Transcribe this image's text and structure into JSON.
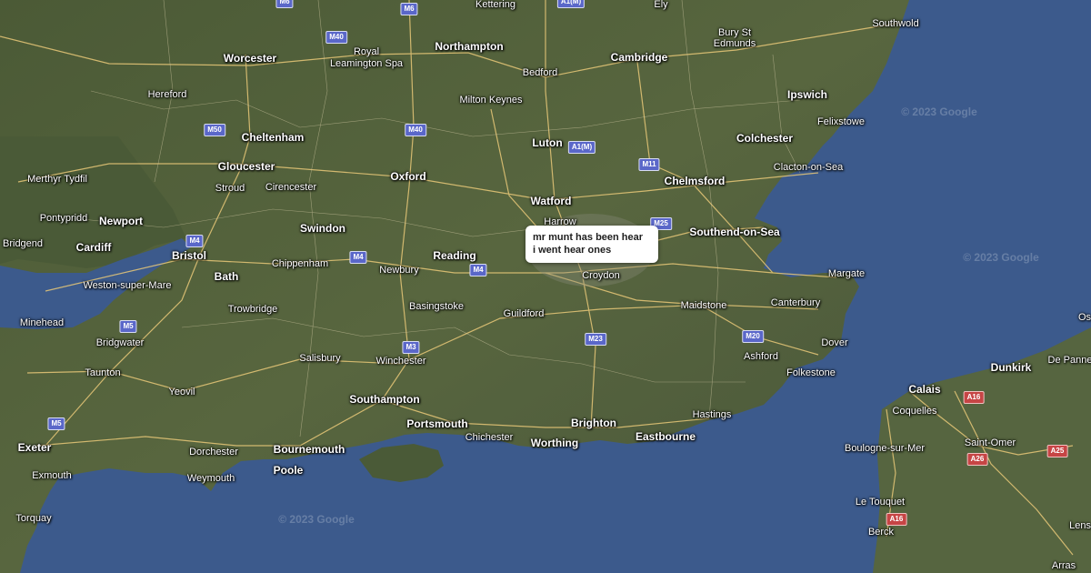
{
  "colors": {
    "sea": "#3c5a8c",
    "land_dark": "#3a4a2d",
    "land_mid": "#55643e",
    "land_light": "#6d7650",
    "road_major": "#e8c878",
    "road_minor": "#d9cfa9",
    "motorway_shield": "#5a67c9",
    "a_road_shield": "#c64545"
  },
  "balloon": {
    "line1": "mr munt has been hear",
    "line2": "i went hear ones"
  },
  "towns": [
    "Kettering",
    "Ely",
    "Bury St",
    "Edmunds",
    "Southwold",
    "Worcester",
    "Royal",
    "Leamington Spa",
    "Northampton",
    "Cambridge",
    "Bedford",
    "Hereford",
    "Milton Keynes",
    "Ipswich",
    "Felixstowe",
    "Cheltenham",
    "Luton",
    "Colchester",
    "Gloucester",
    "Clacton-on-Sea",
    "Merthyr Tydfil",
    "Stroud",
    "Cirencester",
    "Oxford",
    "Chelmsford",
    "Watford",
    "Harrow",
    "Pontypridd",
    "Newport",
    "Swindon",
    "Southend-on-Sea",
    "Bridgend",
    "Cardiff",
    "Reading",
    "Bristol",
    "Chippenham",
    "Newbury",
    "Croydon",
    "Margate",
    "Bath",
    "Weston-super-Mare",
    "Basingstoke",
    "Guildford",
    "Maidstone",
    "Canterbury",
    "Minehead",
    "Trowbridge",
    "Bridgwater",
    "Dover",
    "Salisbury",
    "Ashford",
    "Winchester",
    "Folkestone",
    "Taunton",
    "Yeovil",
    "Southampton",
    "Hastings",
    "Portsmouth",
    "Brighton",
    "Chichester",
    "Eastbourne",
    "Worthing",
    "Exeter",
    "Dorchester",
    "Bournemouth",
    "Poole",
    "Weymouth",
    "Exmouth",
    "Torquay",
    "Calais",
    "Dunkirk",
    "De Panne",
    "Coquelles",
    "Saint-Omer",
    "Boulogne-sur-Mer",
    "Le Touquet",
    "Berck",
    "Arras",
    "Lens",
    "Os"
  ],
  "roads": [
    "M6",
    "M40",
    "A1(M)",
    "M50",
    "M11",
    "M4",
    "M25",
    "M5",
    "M3",
    "M23",
    "M20",
    "A16",
    "A26",
    "A25"
  ],
  "watermark": "© 2023 Google"
}
